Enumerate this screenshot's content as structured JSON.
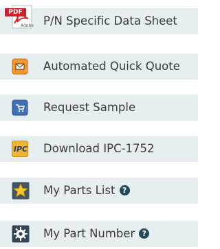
{
  "menu": {
    "items": [
      {
        "label": "P/N Specific Data Sheet",
        "icon": "pdf-icon"
      },
      {
        "label": "Automated Quick Quote",
        "icon": "envelope-icon"
      },
      {
        "label": "Request Sample",
        "icon": "cart-icon"
      },
      {
        "label": "Download IPC-1752",
        "icon": "ipc-icon",
        "icon_text": "IPC"
      },
      {
        "label": "My Parts List",
        "icon": "star-icon",
        "help": "?"
      },
      {
        "label": "My Part Number",
        "icon": "gear-icon",
        "help": "?"
      }
    ],
    "pdf_badge": "PDF",
    "pdf_brand": "Adobe"
  },
  "colors": {
    "row_background": "#e6eef0",
    "label_text": "#3a3a3a",
    "help_badge": "#24495b",
    "orange_icon": "#f2962f",
    "blue_icon": "#3f71b8",
    "ipc_icon": "#f3b431",
    "star_fill": "#f7c928",
    "gear_bg": "#334556"
  }
}
